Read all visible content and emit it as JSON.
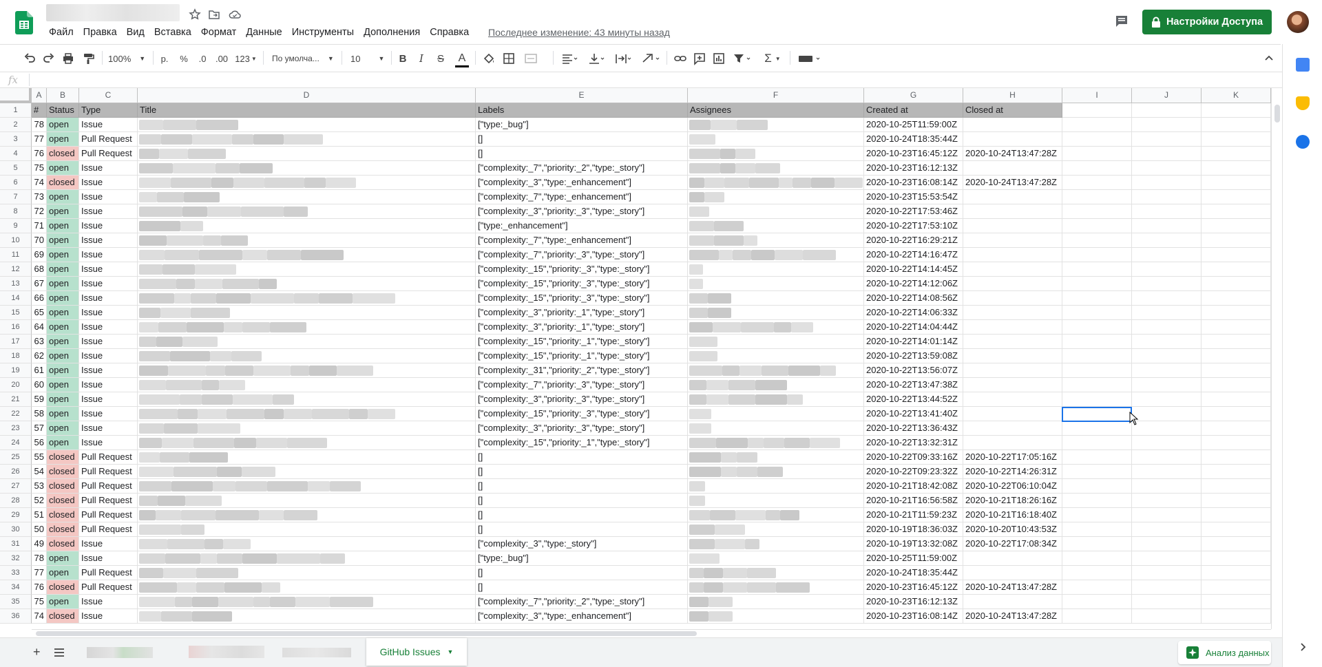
{
  "menu": [
    "Файл",
    "Правка",
    "Вид",
    "Вставка",
    "Формат",
    "Данные",
    "Инструменты",
    "Дополнения",
    "Справка"
  ],
  "last_edit": "Последнее изменение: 43 минуты назад",
  "share_label": "Настройки Доступа",
  "toolbar": {
    "zoom": "100%",
    "currency": "р.",
    "percent": "%",
    "dec_dec": ".0",
    "dec_inc": ".00",
    "format_more": "123",
    "font": "По умолча...",
    "font_size": "10",
    "bold": "B",
    "italic": "I",
    "strike": "S",
    "text_color": "A"
  },
  "formula_label": "fx",
  "columns": [
    "A",
    "B",
    "C",
    "D",
    "E",
    "F",
    "G",
    "H",
    "I",
    "J",
    "K"
  ],
  "header_row": {
    "num": "#",
    "status": "Status",
    "type": "Type",
    "title": "Title",
    "labels": "Labels",
    "assignees": "Assignees",
    "created": "Created at",
    "closed": "Closed at"
  },
  "rows": [
    {
      "r": "2",
      "n": "78",
      "s": "open",
      "t": "Issue",
      "l": "[\"type:_bug\"]",
      "c": "2020-10-25T11:59:00Z",
      "x": ""
    },
    {
      "r": "3",
      "n": "77",
      "s": "open",
      "t": "Pull Request",
      "l": "[]",
      "c": "2020-10-24T18:35:44Z",
      "x": ""
    },
    {
      "r": "4",
      "n": "76",
      "s": "closed",
      "t": "Pull Request",
      "l": "[]",
      "c": "2020-10-23T16:45:12Z",
      "x": "2020-10-24T13:47:28Z"
    },
    {
      "r": "5",
      "n": "75",
      "s": "open",
      "t": "Issue",
      "l": "[\"complexity:_7\",\"priority:_2\",\"type:_story\"]",
      "c": "2020-10-23T16:12:13Z",
      "x": ""
    },
    {
      "r": "6",
      "n": "74",
      "s": "closed",
      "t": "Issue",
      "l": "[\"complexity:_3\",\"type:_enhancement\"]",
      "c": "2020-10-23T16:08:14Z",
      "x": "2020-10-24T13:47:28Z"
    },
    {
      "r": "7",
      "n": "73",
      "s": "open",
      "t": "Issue",
      "l": "[\"complexity:_7\",\"type:_enhancement\"]",
      "c": "2020-10-23T15:53:54Z",
      "x": ""
    },
    {
      "r": "8",
      "n": "72",
      "s": "open",
      "t": "Issue",
      "l": "[\"complexity:_3\",\"priority:_3\",\"type:_story\"]",
      "c": "2020-10-22T17:53:46Z",
      "x": ""
    },
    {
      "r": "9",
      "n": "71",
      "s": "open",
      "t": "Issue",
      "l": "[\"type:_enhancement\"]",
      "c": "2020-10-22T17:53:10Z",
      "x": ""
    },
    {
      "r": "10",
      "n": "70",
      "s": "open",
      "t": "Issue",
      "l": "[\"complexity:_7\",\"type:_enhancement\"]",
      "c": "2020-10-22T16:29:21Z",
      "x": ""
    },
    {
      "r": "11",
      "n": "69",
      "s": "open",
      "t": "Issue",
      "l": "[\"complexity:_7\",\"priority:_3\",\"type:_story\"]",
      "c": "2020-10-22T14:16:47Z",
      "x": ""
    },
    {
      "r": "12",
      "n": "68",
      "s": "open",
      "t": "Issue",
      "l": "[\"complexity:_15\",\"priority:_3\",\"type:_story\"]",
      "c": "2020-10-22T14:14:45Z",
      "x": ""
    },
    {
      "r": "13",
      "n": "67",
      "s": "open",
      "t": "Issue",
      "l": "[\"complexity:_15\",\"priority:_3\",\"type:_story\"]",
      "c": "2020-10-22T14:12:06Z",
      "x": ""
    },
    {
      "r": "14",
      "n": "66",
      "s": "open",
      "t": "Issue",
      "l": "[\"complexity:_15\",\"priority:_3\",\"type:_story\"]",
      "c": "2020-10-22T14:08:56Z",
      "x": ""
    },
    {
      "r": "15",
      "n": "65",
      "s": "open",
      "t": "Issue",
      "l": "[\"complexity:_3\",\"priority:_1\",\"type:_story\"]",
      "c": "2020-10-22T14:06:33Z",
      "x": ""
    },
    {
      "r": "16",
      "n": "64",
      "s": "open",
      "t": "Issue",
      "l": "[\"complexity:_3\",\"priority:_1\",\"type:_story\"]",
      "c": "2020-10-22T14:04:44Z",
      "x": ""
    },
    {
      "r": "17",
      "n": "63",
      "s": "open",
      "t": "Issue",
      "l": "[\"complexity:_15\",\"priority:_1\",\"type:_story\"]",
      "c": "2020-10-22T14:01:14Z",
      "x": ""
    },
    {
      "r": "18",
      "n": "62",
      "s": "open",
      "t": "Issue",
      "l": "[\"complexity:_15\",\"priority:_1\",\"type:_story\"]",
      "c": "2020-10-22T13:59:08Z",
      "x": ""
    },
    {
      "r": "19",
      "n": "61",
      "s": "open",
      "t": "Issue",
      "l": "[\"complexity:_31\",\"priority:_2\",\"type:_story\"]",
      "c": "2020-10-22T13:56:07Z",
      "x": ""
    },
    {
      "r": "20",
      "n": "60",
      "s": "open",
      "t": "Issue",
      "l": "[\"complexity:_7\",\"priority:_3\",\"type:_story\"]",
      "c": "2020-10-22T13:47:38Z",
      "x": ""
    },
    {
      "r": "21",
      "n": "59",
      "s": "open",
      "t": "Issue",
      "l": "[\"complexity:_3\",\"priority:_3\",\"type:_story\"]",
      "c": "2020-10-22T13:44:52Z",
      "x": ""
    },
    {
      "r": "22",
      "n": "58",
      "s": "open",
      "t": "Issue",
      "l": "[\"complexity:_15\",\"priority:_3\",\"type:_story\"]",
      "c": "2020-10-22T13:41:40Z",
      "x": ""
    },
    {
      "r": "23",
      "n": "57",
      "s": "open",
      "t": "Issue",
      "l": "[\"complexity:_3\",\"priority:_3\",\"type:_story\"]",
      "c": "2020-10-22T13:36:43Z",
      "x": ""
    },
    {
      "r": "24",
      "n": "56",
      "s": "open",
      "t": "Issue",
      "l": "[\"complexity:_15\",\"priority:_1\",\"type:_story\"]",
      "c": "2020-10-22T13:32:31Z",
      "x": ""
    },
    {
      "r": "25",
      "n": "55",
      "s": "closed",
      "t": "Pull Request",
      "l": "[]",
      "c": "2020-10-22T09:33:16Z",
      "x": "2020-10-22T17:05:16Z"
    },
    {
      "r": "26",
      "n": "54",
      "s": "closed",
      "t": "Pull Request",
      "l": "[]",
      "c": "2020-10-22T09:23:32Z",
      "x": "2020-10-22T14:26:31Z"
    },
    {
      "r": "27",
      "n": "53",
      "s": "closed",
      "t": "Pull Request",
      "l": "[]",
      "c": "2020-10-21T18:42:08Z",
      "x": "2020-10-22T06:10:04Z"
    },
    {
      "r": "28",
      "n": "52",
      "s": "closed",
      "t": "Pull Request",
      "l": "[]",
      "c": "2020-10-21T16:56:58Z",
      "x": "2020-10-21T18:26:16Z"
    },
    {
      "r": "29",
      "n": "51",
      "s": "closed",
      "t": "Pull Request",
      "l": "[]",
      "c": "2020-10-21T11:59:23Z",
      "x": "2020-10-21T16:18:40Z"
    },
    {
      "r": "30",
      "n": "50",
      "s": "closed",
      "t": "Pull Request",
      "l": "[]",
      "c": "2020-10-19T18:36:03Z",
      "x": "2020-10-20T10:43:53Z"
    },
    {
      "r": "31",
      "n": "49",
      "s": "closed",
      "t": "Issue",
      "l": "[\"complexity:_3\",\"type:_story\"]",
      "c": "2020-10-19T13:32:08Z",
      "x": "2020-10-22T17:08:34Z"
    },
    {
      "r": "32",
      "n": "78",
      "s": "open",
      "t": "Issue",
      "l": "[\"type:_bug\"]",
      "c": "2020-10-25T11:59:00Z",
      "x": ""
    },
    {
      "r": "33",
      "n": "77",
      "s": "open",
      "t": "Pull Request",
      "l": "[]",
      "c": "2020-10-24T18:35:44Z",
      "x": ""
    },
    {
      "r": "34",
      "n": "76",
      "s": "closed",
      "t": "Pull Request",
      "l": "[]",
      "c": "2020-10-23T16:45:12Z",
      "x": "2020-10-24T13:47:28Z"
    },
    {
      "r": "35",
      "n": "75",
      "s": "open",
      "t": "Issue",
      "l": "[\"complexity:_7\",\"priority:_2\",\"type:_story\"]",
      "c": "2020-10-23T16:12:13Z",
      "x": ""
    },
    {
      "r": "36",
      "n": "74",
      "s": "closed",
      "t": "Issue",
      "l": "[\"complexity:_3\",\"type:_enhancement\"]",
      "c": "2020-10-23T16:08:14Z",
      "x": "2020-10-24T13:47:28Z"
    }
  ],
  "sheet_tab_active": "GitHub Issues",
  "explore_label": "Анализ данных",
  "colors": {
    "open": "#b7e1cd",
    "closed": "#f4c7c3",
    "brand": "#188038",
    "header": "#b7b7b7",
    "selection": "#1a73e8"
  }
}
